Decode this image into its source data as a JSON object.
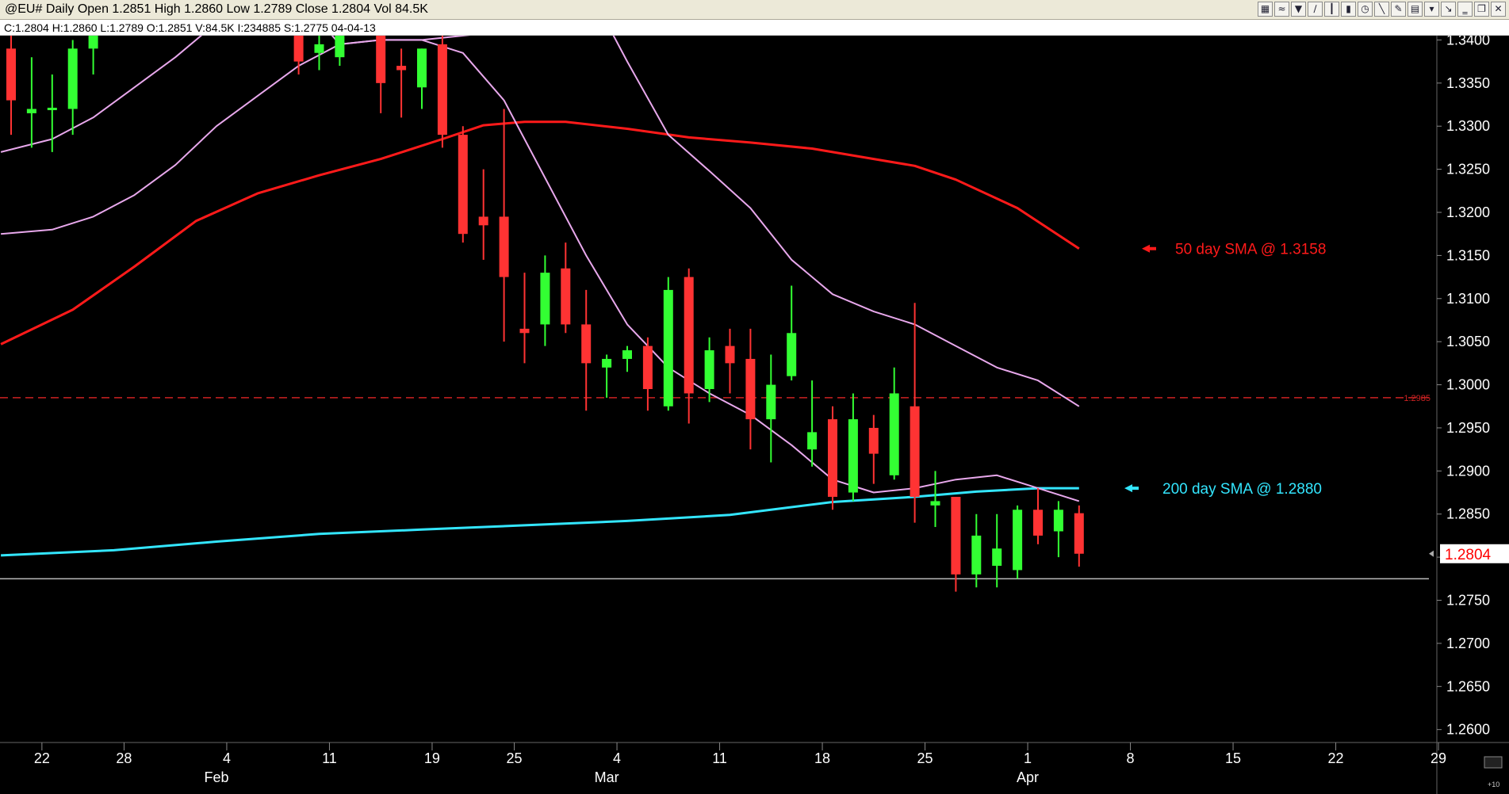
{
  "window": {
    "title": "@EU# Daily Open 1.2851 High 1.2860 Low 1.2789 Close 1.2804 Vol 84.5K",
    "info": "C:1.2804  H:1.2860  L:1.2789  O:1.2851  V:84.5K  I:234885  S:1.2775  04-04-13",
    "toolbar_icons": [
      "chart-icon",
      "indicator-icon",
      "arrow-down-icon",
      "draw-icon",
      "bar-icon",
      "candle-icon",
      "clock-icon",
      "line-icon",
      "pencil-icon",
      "grid-icon",
      "trash-icon",
      "scroll-icon",
      "minimize-icon",
      "restore-icon",
      "close-icon"
    ]
  },
  "chart_data": {
    "type": "candlestick",
    "ylim": [
      1.2585,
      1.3405
    ],
    "y_ticks": [
      "1.3400",
      "1.3350",
      "1.3300",
      "1.3250",
      "1.3200",
      "1.3150",
      "1.3100",
      "1.3050",
      "1.3000",
      "1.2950",
      "1.2900",
      "1.2850",
      "1.2800",
      "1.2750",
      "1.2700",
      "1.2650",
      "1.2600"
    ],
    "x_day_ticks": [
      {
        "label": "22",
        "slot": 1.5
      },
      {
        "label": "28",
        "slot": 5.5
      },
      {
        "label": "4",
        "slot": 10.5
      },
      {
        "label": "11",
        "slot": 15.5
      },
      {
        "label": "19",
        "slot": 20.5
      },
      {
        "label": "25",
        "slot": 24.5
      },
      {
        "label": "4",
        "slot": 29.5
      },
      {
        "label": "11",
        "slot": 34.5
      },
      {
        "label": "18",
        "slot": 39.5
      },
      {
        "label": "25",
        "slot": 44.5
      },
      {
        "label": "1",
        "slot": 49.5
      },
      {
        "label": "8",
        "slot": 54.5
      },
      {
        "label": "15",
        "slot": 59.5
      },
      {
        "label": "22",
        "slot": 64.5
      },
      {
        "label": "29",
        "slot": 69.5
      }
    ],
    "x_month_ticks": [
      {
        "label": "Feb",
        "slot": 10
      },
      {
        "label": "Mar",
        "slot": 29
      },
      {
        "label": "Apr",
        "slot": 49.5
      }
    ],
    "candles": [
      {
        "i": 0,
        "o": 1.339,
        "h": 1.342,
        "l": 1.329,
        "c": 1.333
      },
      {
        "i": 1,
        "o": 1.3315,
        "h": 1.338,
        "l": 1.3275,
        "c": 1.332
      },
      {
        "i": 2,
        "o": 1.332,
        "h": 1.336,
        "l": 1.327,
        "c": 1.332
      },
      {
        "i": 3,
        "o": 1.332,
        "h": 1.34,
        "l": 1.329,
        "c": 1.339
      },
      {
        "i": 4,
        "o": 1.339,
        "h": 1.345,
        "l": 1.336,
        "c": 1.343
      },
      {
        "i": 14,
        "o": 1.341,
        "h": 1.343,
        "l": 1.336,
        "c": 1.3375
      },
      {
        "i": 15,
        "o": 1.3385,
        "h": 1.341,
        "l": 1.3365,
        "c": 1.3395
      },
      {
        "i": 16,
        "o": 1.338,
        "h": 1.3425,
        "l": 1.337,
        "c": 1.341
      },
      {
        "i": 18,
        "o": 1.341,
        "h": 1.343,
        "l": 1.3315,
        "c": 1.335
      },
      {
        "i": 19,
        "o": 1.337,
        "h": 1.339,
        "l": 1.331,
        "c": 1.3365
      },
      {
        "i": 20,
        "o": 1.3345,
        "h": 1.339,
        "l": 1.332,
        "c": 1.339
      },
      {
        "i": 21,
        "o": 1.3395,
        "h": 1.341,
        "l": 1.3275,
        "c": 1.329
      },
      {
        "i": 22,
        "o": 1.329,
        "h": 1.33,
        "l": 1.3165,
        "c": 1.3175
      },
      {
        "i": 23,
        "o": 1.3195,
        "h": 1.325,
        "l": 1.3145,
        "c": 1.3185
      },
      {
        "i": 24,
        "o": 1.3195,
        "h": 1.332,
        "l": 1.305,
        "c": 1.3125
      },
      {
        "i": 25,
        "o": 1.3065,
        "h": 1.313,
        "l": 1.3025,
        "c": 1.306
      },
      {
        "i": 26,
        "o": 1.307,
        "h": 1.315,
        "l": 1.3045,
        "c": 1.313
      },
      {
        "i": 27,
        "o": 1.3135,
        "h": 1.3165,
        "l": 1.306,
        "c": 1.307
      },
      {
        "i": 28,
        "o": 1.307,
        "h": 1.311,
        "l": 1.297,
        "c": 1.3025
      },
      {
        "i": 29,
        "o": 1.302,
        "h": 1.3035,
        "l": 1.2985,
        "c": 1.303
      },
      {
        "i": 30,
        "o": 1.303,
        "h": 1.3045,
        "l": 1.3015,
        "c": 1.304
      },
      {
        "i": 31,
        "o": 1.3045,
        "h": 1.3055,
        "l": 1.297,
        "c": 1.2995
      },
      {
        "i": 32,
        "o": 1.2975,
        "h": 1.3125,
        "l": 1.297,
        "c": 1.311
      },
      {
        "i": 33,
        "o": 1.3125,
        "h": 1.3135,
        "l": 1.2955,
        "c": 1.299
      },
      {
        "i": 34,
        "o": 1.2995,
        "h": 1.3055,
        "l": 1.298,
        "c": 1.304
      },
      {
        "i": 35,
        "o": 1.3045,
        "h": 1.3065,
        "l": 1.299,
        "c": 1.3025
      },
      {
        "i": 36,
        "o": 1.303,
        "h": 1.3065,
        "l": 1.2925,
        "c": 1.296
      },
      {
        "i": 37,
        "o": 1.296,
        "h": 1.3035,
        "l": 1.291,
        "c": 1.3
      },
      {
        "i": 38,
        "o": 1.301,
        "h": 1.3115,
        "l": 1.3005,
        "c": 1.306
      },
      {
        "i": 39,
        "o": 1.2925,
        "h": 1.3005,
        "l": 1.2905,
        "c": 1.2945
      },
      {
        "i": 40,
        "o": 1.296,
        "h": 1.2975,
        "l": 1.2855,
        "c": 1.287
      },
      {
        "i": 41,
        "o": 1.2875,
        "h": 1.299,
        "l": 1.2865,
        "c": 1.296
      },
      {
        "i": 42,
        "o": 1.295,
        "h": 1.2965,
        "l": 1.2885,
        "c": 1.292
      },
      {
        "i": 43,
        "o": 1.2895,
        "h": 1.302,
        "l": 1.289,
        "c": 1.299
      },
      {
        "i": 44,
        "o": 1.2975,
        "h": 1.3095,
        "l": 1.284,
        "c": 1.287
      },
      {
        "i": 45,
        "o": 1.286,
        "h": 1.29,
        "l": 1.2835,
        "c": 1.2865
      },
      {
        "i": 46,
        "o": 1.287,
        "h": 1.287,
        "l": 1.276,
        "c": 1.278
      },
      {
        "i": 47,
        "o": 1.278,
        "h": 1.285,
        "l": 1.2765,
        "c": 1.2825
      },
      {
        "i": 48,
        "o": 1.279,
        "h": 1.285,
        "l": 1.2765,
        "c": 1.281
      },
      {
        "i": 49,
        "o": 1.2785,
        "h": 1.286,
        "l": 1.2775,
        "c": 1.2855
      },
      {
        "i": 50,
        "o": 1.2855,
        "h": 1.288,
        "l": 1.2815,
        "c": 1.2825
      },
      {
        "i": 51,
        "o": 1.283,
        "h": 1.2865,
        "l": 1.28,
        "c": 1.2855
      },
      {
        "i": 52,
        "o": 1.2851,
        "h": 1.286,
        "l": 1.2789,
        "c": 1.2804
      }
    ],
    "series": [
      {
        "style": "sma-50",
        "color": "#ff1a1a",
        "points": [
          [
            -0.5,
            1.3047
          ],
          [
            3,
            1.3087
          ],
          [
            6,
            1.3137
          ],
          [
            9,
            1.319
          ],
          [
            12,
            1.3222
          ],
          [
            15,
            1.3243
          ],
          [
            18,
            1.3262
          ],
          [
            21,
            1.3285
          ],
          [
            23,
            1.3301
          ],
          [
            25,
            1.3305
          ],
          [
            27,
            1.3305
          ],
          [
            30,
            1.3297
          ],
          [
            33,
            1.3287
          ],
          [
            36,
            1.3281
          ],
          [
            39,
            1.3274
          ],
          [
            42,
            1.3262
          ],
          [
            44,
            1.3254
          ],
          [
            46,
            1.3238
          ],
          [
            49,
            1.3205
          ],
          [
            52,
            1.3158
          ]
        ]
      },
      {
        "style": "sma-200",
        "color": "#33e6ff",
        "points": [
          [
            -0.5,
            1.2802
          ],
          [
            5,
            1.2808
          ],
          [
            10,
            1.2818
          ],
          [
            15,
            1.2827
          ],
          [
            20,
            1.2832
          ],
          [
            25,
            1.2837
          ],
          [
            30,
            1.2842
          ],
          [
            35,
            1.2849
          ],
          [
            40,
            1.2864
          ],
          [
            44,
            1.287
          ],
          [
            47,
            1.2876
          ],
          [
            50,
            1.288
          ],
          [
            52,
            1.288
          ]
        ]
      },
      {
        "style": "band-upper",
        "color": "#e8a8ec",
        "points": [
          [
            -0.5,
            1.327
          ],
          [
            2,
            1.3285
          ],
          [
            4,
            1.331
          ],
          [
            6,
            1.3345
          ],
          [
            8,
            1.338
          ],
          [
            10,
            1.342
          ],
          [
            12,
            1.348
          ],
          [
            14,
            1.345
          ],
          [
            16,
            1.3395
          ],
          [
            18,
            1.34
          ],
          [
            20,
            1.34
          ],
          [
            22,
            1.3385
          ],
          [
            24,
            1.333
          ],
          [
            26,
            1.324
          ],
          [
            28,
            1.315
          ],
          [
            30,
            1.307
          ],
          [
            32,
            1.302
          ],
          [
            34,
            1.299
          ],
          [
            36,
            1.2965
          ],
          [
            38,
            1.293
          ],
          [
            40,
            1.289
          ],
          [
            42,
            1.2875
          ],
          [
            44,
            1.288
          ],
          [
            46,
            1.289
          ],
          [
            48,
            1.2895
          ],
          [
            50,
            1.288
          ],
          [
            52,
            1.2865
          ]
        ]
      },
      {
        "style": "band-lower",
        "color": "#e8a8ec",
        "points": [
          [
            -0.5,
            1.3175
          ],
          [
            2,
            1.318
          ],
          [
            4,
            1.3195
          ],
          [
            6,
            1.322
          ],
          [
            8,
            1.3255
          ],
          [
            10,
            1.33
          ],
          [
            12,
            1.3335
          ],
          [
            14,
            1.337
          ],
          [
            16,
            1.3395
          ],
          [
            18,
            1.34
          ],
          [
            20,
            1.34
          ],
          [
            22,
            1.3405
          ],
          [
            24,
            1.341
          ],
          [
            26,
            1.342
          ],
          [
            28,
            1.345
          ],
          [
            29,
            1.342
          ],
          [
            30,
            1.3375
          ],
          [
            32,
            1.329
          ],
          [
            34,
            1.3248
          ],
          [
            36,
            1.3205
          ],
          [
            38,
            1.3145
          ],
          [
            40,
            1.3105
          ],
          [
            42,
            1.3085
          ],
          [
            44,
            1.307
          ],
          [
            46,
            1.3045
          ],
          [
            48,
            1.302
          ],
          [
            50,
            1.3005
          ],
          [
            52,
            1.2975
          ]
        ]
      }
    ],
    "ref_lines": [
      {
        "style": "dashed",
        "color": "#cc2222",
        "value": 1.2985,
        "tag": "1.2985"
      },
      {
        "style": "solid",
        "color": "#bbbbbb",
        "value": 1.2775
      }
    ],
    "annotations": [
      {
        "text": "50 day SMA @ 1.3158",
        "color": "#ff1a1a",
        "value": 1.3158
      },
      {
        "text": "200 day SMA @ 1.2880",
        "color": "#33e6ff",
        "value": 1.288
      }
    ],
    "last_price": {
      "text": "1.2804",
      "value": 1.2804
    },
    "corner_label": "+10"
  }
}
